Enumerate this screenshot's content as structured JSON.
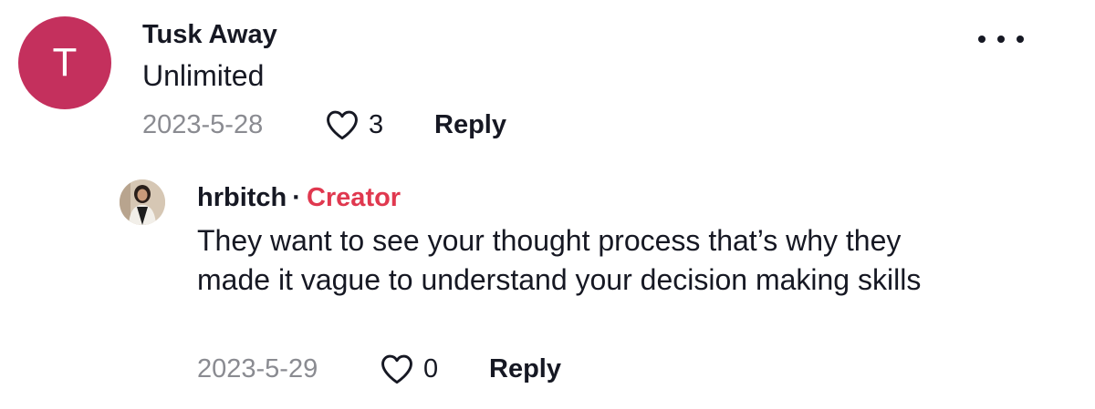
{
  "comments": [
    {
      "avatar_letter": "T",
      "avatar_color": "#c4305d",
      "username": "Tusk Away",
      "text": "Unlimited",
      "date": "2023-5-28",
      "likes": "3",
      "reply_label": "Reply",
      "more_icon": "more-horizontal-icon"
    },
    {
      "avatar": "user-photo",
      "username": "hrbitch",
      "separator": "·",
      "badge": "Creator",
      "badge_color": "#e0384f",
      "text": "They want to see your thought process that’s why they made it vague to understand your decision making skills",
      "date": "2023-5-29",
      "likes": "0",
      "reply_label": "Reply"
    }
  ]
}
